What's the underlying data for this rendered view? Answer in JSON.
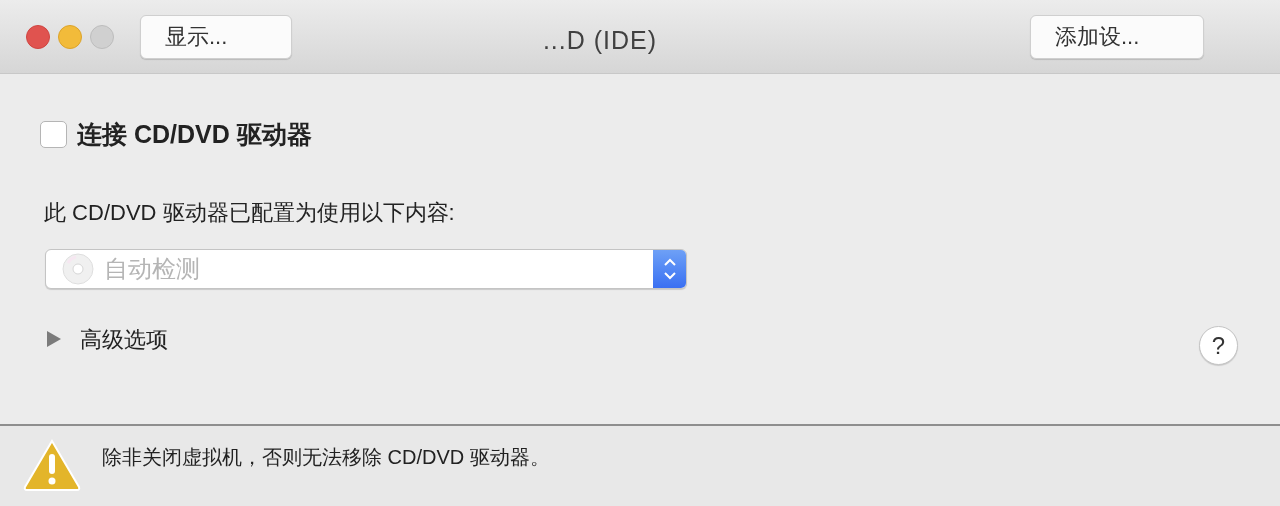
{
  "toolbar": {
    "left_button": "显示...",
    "title": "...D (IDE)",
    "right_button": "添加设..."
  },
  "connect": {
    "label": "连接 CD/DVD 驱动器",
    "checked": false
  },
  "config_label": "此 CD/DVD 驱动器已配置为使用以下内容:",
  "source_select": {
    "value": "自动检测",
    "disabled": true
  },
  "advanced": {
    "label": "高级选项",
    "expanded": false
  },
  "help": "?",
  "footer": {
    "message": "除非关闭虚拟机，否则无法移除 CD/DVD 驱动器。"
  }
}
